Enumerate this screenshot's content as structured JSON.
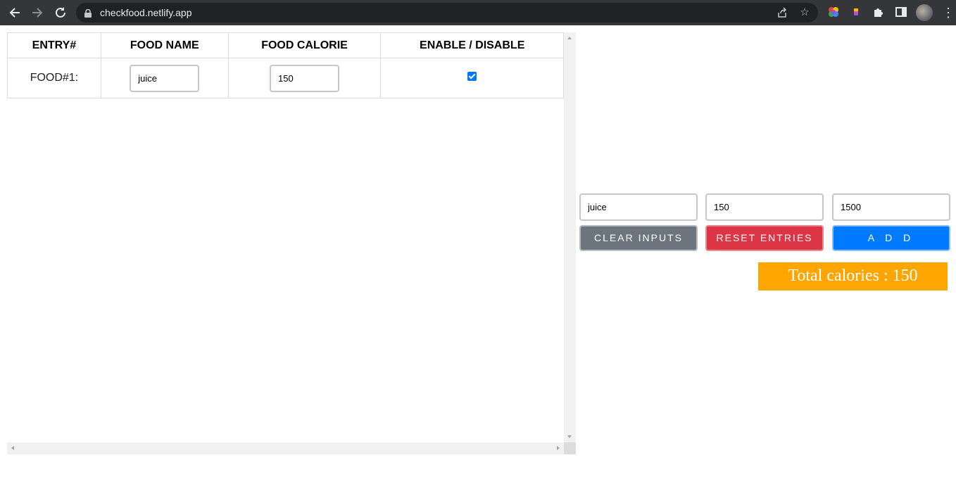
{
  "browser": {
    "url": "checkfood.netlify.app"
  },
  "table": {
    "headers": [
      "ENTRY#",
      "FOOD NAME",
      "FOOD CALORIE",
      "ENABLE / DISABLE"
    ],
    "rows": [
      {
        "entry": "FOOD#1:",
        "food_name": "juice",
        "food_calorie": "150",
        "enabled": true
      }
    ]
  },
  "form": {
    "food_name_value": "juice",
    "food_calorie_value": "150",
    "calorie_limit_value": "1500",
    "clear_label": "CLEAR INPUTS",
    "reset_label": "RESET ENTRIES",
    "add_label": "A D D"
  },
  "total": {
    "text": "Total calories : 150"
  },
  "colors": {
    "clear_button": "#6c757d",
    "reset_button": "#dc3545",
    "add_button": "#007bff",
    "total_background": "#ffa500",
    "checkbox": "#0075ff"
  },
  "icons": [
    "back-icon",
    "forward-icon",
    "reload-icon",
    "lock-icon",
    "share-icon",
    "bookmark-star-icon",
    "extension-color-icon",
    "extension-bar-icon",
    "puzzle-icon",
    "side-panel-icon",
    "profile-avatar",
    "menu-dots-icon"
  ]
}
